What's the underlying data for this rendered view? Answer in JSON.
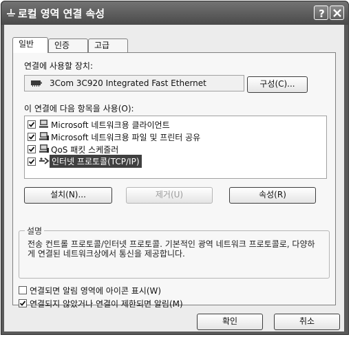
{
  "window": {
    "title": "로컬 영역 연결 속성"
  },
  "title_buttons": {
    "help": "?",
    "close": "✕"
  },
  "tabs": [
    {
      "label": "일반"
    },
    {
      "label": "인증"
    },
    {
      "label": "고급"
    }
  ],
  "connect_using": {
    "label": "연결에 사용할 장치:",
    "device": "3Com 3C920 Integrated Fast Ethernet",
    "configure_button": "구성(C)..."
  },
  "items_section": {
    "label": "이 연결에 다음 항목을 사용(O):",
    "items": [
      {
        "label": "Microsoft 네트워크용 클라이언트",
        "checked": true,
        "icon": "network-client-icon"
      },
      {
        "label": "Microsoft 네트워크용 파일 및 프린터 공유",
        "checked": true,
        "icon": "network-service-icon"
      },
      {
        "label": "QoS 패킷 스케줄러",
        "checked": true,
        "icon": "network-service-icon"
      },
      {
        "label": "인터넷 프로토콜(TCP/IP)",
        "checked": true,
        "icon": "protocol-icon",
        "selected": true
      }
    ]
  },
  "item_buttons": {
    "install": "설치(N)...",
    "uninstall": "제거(U)",
    "properties": "속성(R)"
  },
  "description": {
    "legend": "설명",
    "text": "전송 컨트롤 프로토콜/인터넷 프로토콜. 기본적인 광역 네트워크 프로토콜로, 다양하게 연결된 네트워크상에서 통신을 제공합니다."
  },
  "options": [
    {
      "label": "연결되면 알림 영역에 아이콘 표시(W)",
      "checked": false
    },
    {
      "label": "연결되지 않았거나 연결이 제한되면 알림(M)",
      "checked": true
    }
  ],
  "dialog_buttons": {
    "ok": "확인",
    "cancel": "취소"
  },
  "colors": {
    "selection": "#404040",
    "titlebar": "#5a5a5a"
  }
}
